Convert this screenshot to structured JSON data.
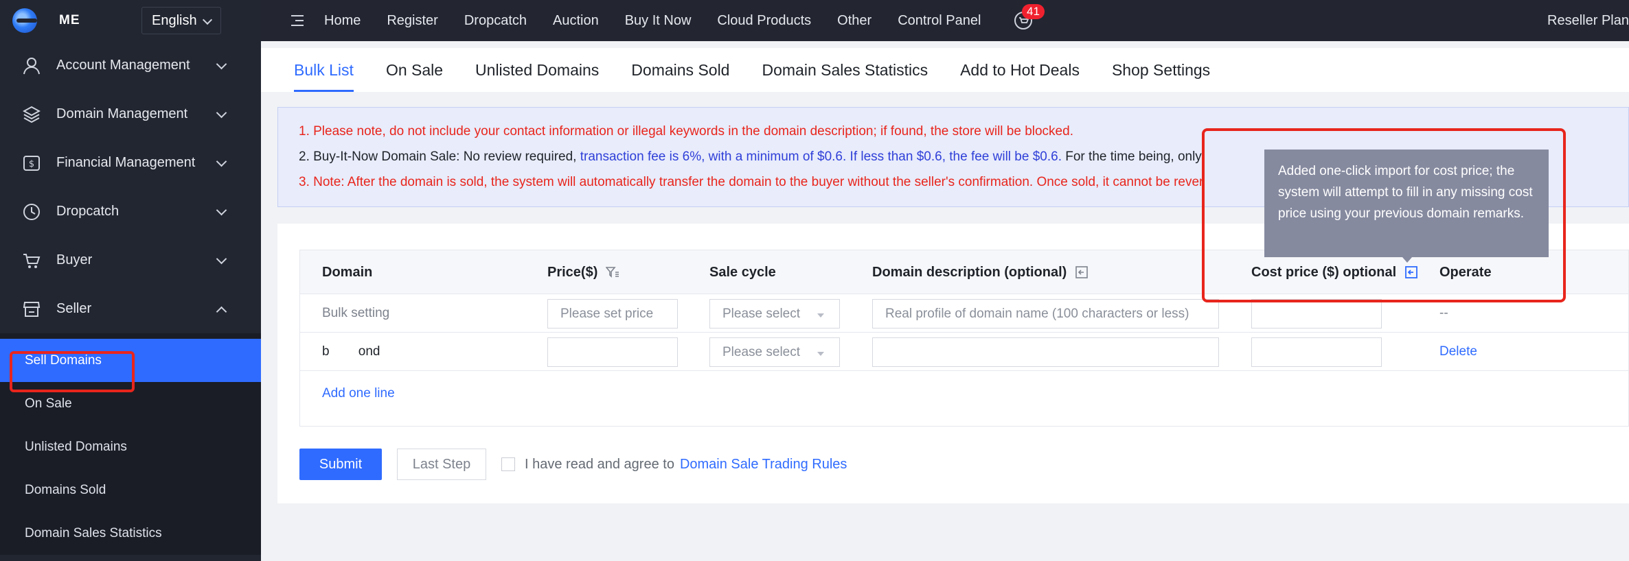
{
  "sidebar": {
    "brand": "ME",
    "language": "English",
    "menu": [
      {
        "label": "Account Management",
        "icon": "user-icon"
      },
      {
        "label": "Domain Management",
        "icon": "layers-icon"
      },
      {
        "label": "Financial Management",
        "icon": "dollar-icon"
      },
      {
        "label": "Dropcatch",
        "icon": "clock-icon"
      },
      {
        "label": "Buyer",
        "icon": "cart-icon"
      },
      {
        "label": "Seller",
        "icon": "store-icon"
      }
    ],
    "seller_sub": [
      "Sell Domains",
      "On Sale",
      "Unlisted Domains",
      "Domains Sold",
      "Domain Sales Statistics"
    ]
  },
  "topnav": {
    "items": [
      "Home",
      "Register",
      "Dropcatch",
      "Auction",
      "Buy It Now",
      "Cloud Products",
      "Other",
      "Control Panel"
    ],
    "cart_count": "41",
    "right": "Reseller Plan"
  },
  "tabs": [
    "Bulk List",
    "On Sale",
    "Unlisted Domains",
    "Domains Sold",
    "Domain Sales Statistics",
    "Add to Hot Deals",
    "Shop Settings"
  ],
  "notice": {
    "line1": "1. Please note, do not include your contact information or illegal keywords in the domain description; if found, the store will be blocked.",
    "line2_a": "2. Buy-It-Now Domain Sale: No review required, ",
    "line2_b": "transaction fee is 6%, with a minimum of $0.6. If less than $0.6, the fee will be $0.6.",
    "line2_c": " For the time being, only",
    "line3": "3. Note: After the domain is sold, the system will automatically transfer the domain to the buyer without the seller's confirmation. Once sold, it cannot be rever"
  },
  "table": {
    "headers": [
      "Domain",
      "Price($)",
      "Sale cycle",
      "Domain description (optional)",
      "Cost price ($) optional",
      "Operate"
    ],
    "bulk_row": {
      "label": "Bulk setting",
      "price_placeholder": "Please set price",
      "cycle_placeholder": "Please select",
      "desc_placeholder": "Real profile of domain name (100 characters or less)",
      "operate": "--"
    },
    "row": {
      "domain": "b        ond",
      "cycle_placeholder": "Please select",
      "operate": "Delete"
    },
    "add_line": "Add one line"
  },
  "actions": {
    "submit": "Submit",
    "last_step": "Last Step",
    "agree_text": "I have read and agree to",
    "rules_link": "Domain Sale Trading Rules"
  },
  "tooltip": "Added one-click import for cost price; the system will attempt to fill in any missing cost price using your previous domain remarks."
}
